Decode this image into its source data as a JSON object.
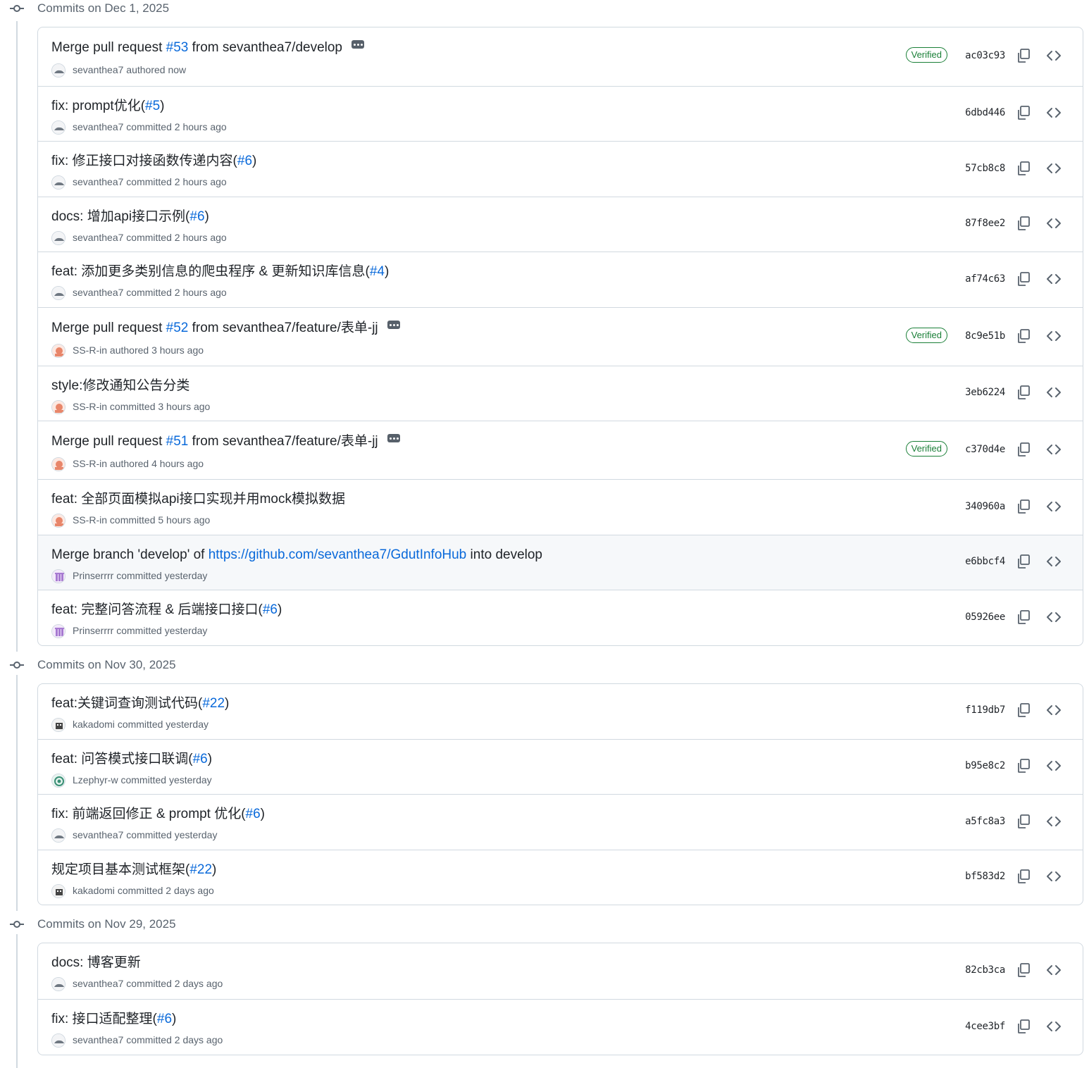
{
  "groups": [
    {
      "date_label": "Commits on Dec 1, 2025",
      "commits": [
        {
          "title_parts": [
            "Merge pull request ",
            "#53",
            " from sevanthea7/develop"
          ],
          "is_merge": true,
          "author": "sevanthea7",
          "action": "authored",
          "time": "now",
          "sha": "ac03c93",
          "verified": "Verified",
          "avatar": "sevanthea7"
        },
        {
          "title_parts": [
            "fix: prompt优化(",
            "#5",
            ")"
          ],
          "author": "sevanthea7",
          "action": "committed",
          "time": "2 hours ago",
          "sha": "6dbd446",
          "avatar": "sevanthea7"
        },
        {
          "title_parts": [
            "fix: 修正接口对接函数传递内容(",
            "#6",
            ")"
          ],
          "author": "sevanthea7",
          "action": "committed",
          "time": "2 hours ago",
          "sha": "57cb8c8",
          "avatar": "sevanthea7"
        },
        {
          "title_parts": [
            "docs: 增加api接口示例(",
            "#6",
            ")"
          ],
          "author": "sevanthea7",
          "action": "committed",
          "time": "2 hours ago",
          "sha": "87f8ee2",
          "avatar": "sevanthea7"
        },
        {
          "title_parts": [
            "feat: 添加更多类别信息的爬虫程序 & 更新知识库信息(",
            "#4",
            ")"
          ],
          "author": "sevanthea7",
          "action": "committed",
          "time": "2 hours ago",
          "sha": "af74c63",
          "avatar": "sevanthea7"
        },
        {
          "title_parts": [
            "Merge pull request ",
            "#52",
            " from sevanthea7/feature/表单-jj"
          ],
          "is_merge": true,
          "author": "SS-R-in",
          "action": "authored",
          "time": "3 hours ago",
          "sha": "8c9e51b",
          "verified": "Verified",
          "avatar": "SS-R-in"
        },
        {
          "title_parts": [
            "style:修改通知公告分类"
          ],
          "author": "SS-R-in",
          "action": "committed",
          "time": "3 hours ago",
          "sha": "3eb6224",
          "avatar": "SS-R-in"
        },
        {
          "title_parts": [
            "Merge pull request ",
            "#51",
            " from sevanthea7/feature/表单-jj"
          ],
          "is_merge": true,
          "author": "SS-R-in",
          "action": "authored",
          "time": "4 hours ago",
          "sha": "c370d4e",
          "verified": "Verified",
          "avatar": "SS-R-in"
        },
        {
          "title_parts": [
            "feat: 全部页面模拟api接口实现并用mock模拟数据"
          ],
          "author": "SS-R-in",
          "action": "committed",
          "time": "5 hours ago",
          "sha": "340960a",
          "avatar": "SS-R-in"
        },
        {
          "title_parts": [
            "Merge branch 'develop' of ",
            "https://github.com/sevanthea7/GdutInfoHub",
            " into develop"
          ],
          "highlight": true,
          "author": "Prinserrrr",
          "action": "committed",
          "time": "yesterday",
          "sha": "e6bbcf4",
          "avatar": "Prinserrrr"
        },
        {
          "title_parts": [
            "feat: 完整问答流程 & 后端接口接口(",
            "#6",
            ")"
          ],
          "author": "Prinserrrr",
          "action": "committed",
          "time": "yesterday",
          "sha": "05926ee",
          "avatar": "Prinserrrr"
        }
      ]
    },
    {
      "date_label": "Commits on Nov 30, 2025",
      "commits": [
        {
          "title_parts": [
            "feat:关键词查询测试代码(",
            "#22",
            ")"
          ],
          "author": "kakadomi",
          "action": "committed",
          "time": "yesterday",
          "sha": "f119db7",
          "avatar": "kakadomi"
        },
        {
          "title_parts": [
            "feat: 问答模式接口联调(",
            "#6",
            ")"
          ],
          "author": "Lzephyr-w",
          "action": "committed",
          "time": "yesterday",
          "sha": "b95e8c2",
          "avatar": "Lzephyr-w"
        },
        {
          "title_parts": [
            "fix: 前端返回修正 & prompt 优化(",
            "#6",
            ")"
          ],
          "author": "sevanthea7",
          "action": "committed",
          "time": "yesterday",
          "sha": "a5fc8a3",
          "avatar": "sevanthea7"
        },
        {
          "title_parts": [
            "规定项目基本测试框架(",
            "#22",
            ")"
          ],
          "author": "kakadomi",
          "action": "committed",
          "time": "2 days ago",
          "sha": "bf583d2",
          "avatar": "kakadomi"
        }
      ]
    },
    {
      "date_label": "Commits on Nov 29, 2025",
      "commits": [
        {
          "title_parts": [
            "docs: 博客更新"
          ],
          "author": "sevanthea7",
          "action": "committed",
          "time": "2 days ago",
          "sha": "82cb3ca",
          "avatar": "sevanthea7"
        },
        {
          "title_parts": [
            "fix: 接口适配整理(",
            "#6",
            ")"
          ],
          "author": "sevanthea7",
          "action": "committed",
          "time": "2 days ago",
          "sha": "4cee3bf",
          "avatar": "sevanthea7"
        }
      ]
    }
  ],
  "icons": {
    "commit": "git-commit-icon",
    "copy": "copy-icon",
    "browse": "code-icon",
    "more": "kebab-horizontal-icon"
  },
  "colors": {
    "link": "#0969da",
    "verified": "#1a7f37",
    "muted": "#59636e",
    "border": "#d1d9e0",
    "highlight_row": "#f6f8fa"
  }
}
